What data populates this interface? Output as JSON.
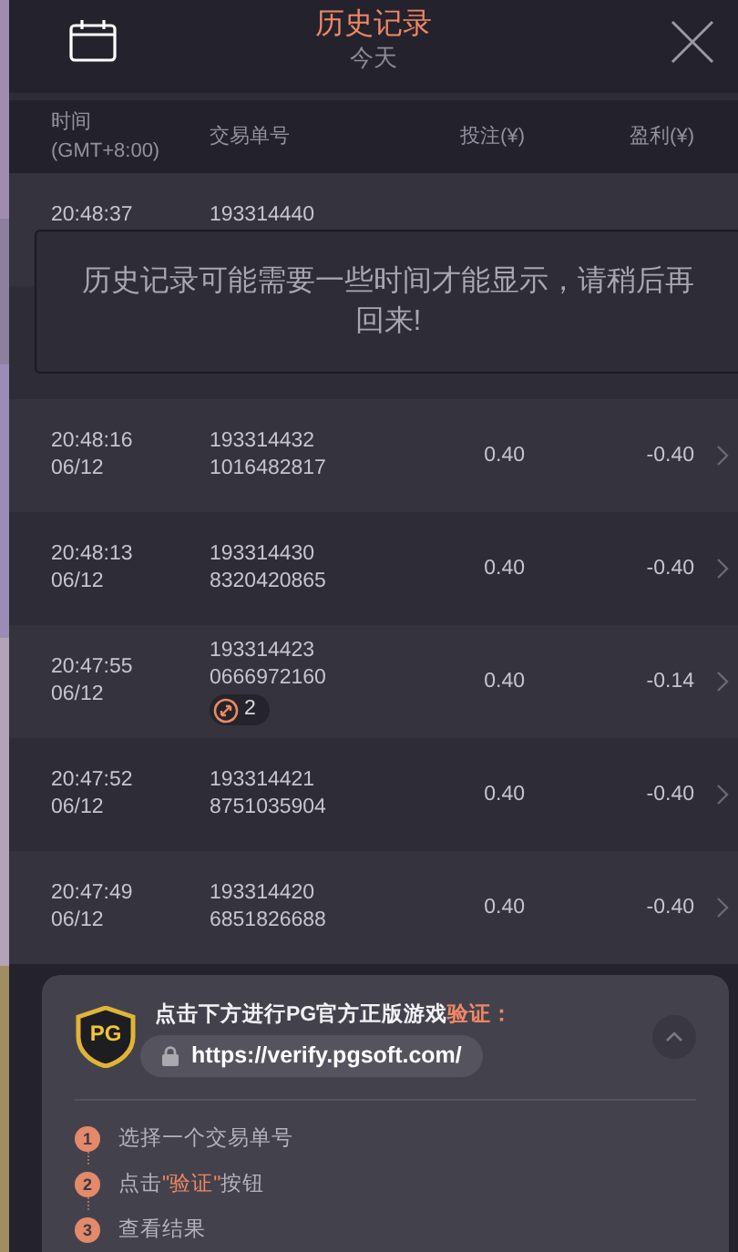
{
  "header": {
    "title": "历史记录",
    "subtitle": "今天"
  },
  "columns": [
    {
      "label": "时间",
      "sub": "(GMT+8:00)"
    },
    {
      "label": "交易单号"
    },
    {
      "label": "投注(¥)"
    },
    {
      "label": "盈利(¥)"
    }
  ],
  "rows": [
    {
      "time": "20:48:37",
      "id": "193314440"
    },
    {
      "time": "20:48:16",
      "date": "06/12",
      "id": "193314432",
      "id2": "1016482817",
      "stake": "0.40",
      "profit": "-0.40"
    },
    {
      "time": "20:48:13",
      "date": "06/12",
      "id": "193314430",
      "id2": "8320420865",
      "stake": "0.40",
      "profit": "-0.40"
    },
    {
      "time": "20:47:55",
      "date": "06/12",
      "id": "193314423",
      "id2": "0666972160",
      "badge": "2",
      "stake": "0.40",
      "profit": "-0.14"
    },
    {
      "time": "20:47:52",
      "date": "06/12",
      "id": "193314421",
      "id2": "8751035904",
      "stake": "0.40",
      "profit": "-0.40"
    },
    {
      "time": "20:47:49",
      "date": "06/12",
      "id": "193314420",
      "id2": "6851826688",
      "stake": "0.40",
      "profit": "-0.40"
    }
  ],
  "notice": "历史记录可能需要一些时间才能显示，请稍后再回来!",
  "verify": {
    "heading": "点击下方进行PG官方正版游戏",
    "heading_accent": "验证：",
    "logo": "PG",
    "url": "https://verify.pgsoft.com/",
    "steps": [
      {
        "number": "1",
        "parts": [
          {
            "text": "选择一个交易单号",
            "accent": false
          }
        ]
      },
      {
        "number": "2",
        "parts": [
          {
            "text": "点击",
            "accent": false
          },
          {
            "text": "\"验证\"",
            "accent": true
          },
          {
            "text": "按钮",
            "accent": false
          }
        ]
      },
      {
        "number": "3",
        "parts": [
          {
            "text": "查看结果",
            "accent": false
          }
        ]
      }
    ]
  }
}
